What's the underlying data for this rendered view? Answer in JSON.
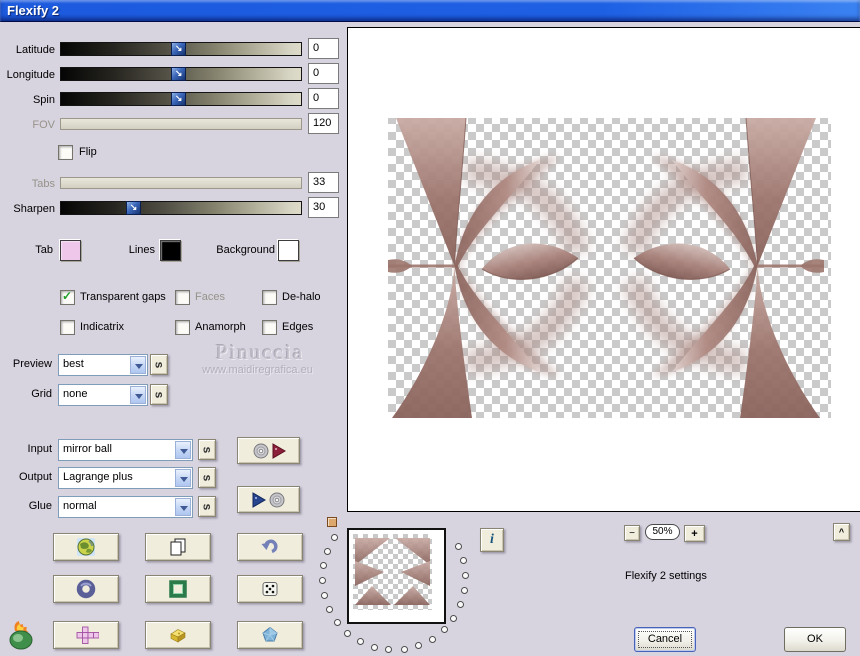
{
  "window": {
    "title": "Flexify 2"
  },
  "sliders": {
    "latitude": {
      "label": "Latitude",
      "value": "0"
    },
    "longitude": {
      "label": "Longitude",
      "value": "0"
    },
    "spin": {
      "label": "Spin",
      "value": "0"
    },
    "fov": {
      "label": "FOV",
      "value": "120"
    },
    "tabs": {
      "label": "Tabs",
      "value": "33"
    },
    "sharpen": {
      "label": "Sharpen",
      "value": "30"
    }
  },
  "flip": {
    "label": "Flip",
    "checked": false
  },
  "swatches": {
    "tab": {
      "label": "Tab",
      "color": "#eec7ea"
    },
    "lines": {
      "label": "Lines",
      "color": "#000000"
    },
    "background": {
      "label": "Background",
      "color": "#ffffff"
    }
  },
  "options": {
    "transparent_gaps": {
      "label": "Transparent gaps",
      "checked": true,
      "check_glyph": "✓"
    },
    "faces": {
      "label": "Faces",
      "checked": false,
      "disabled": true
    },
    "dehalo": {
      "label": "De-halo",
      "checked": false
    },
    "indicatrix": {
      "label": "Indicatrix",
      "checked": false
    },
    "anamorph": {
      "label": "Anamorph",
      "checked": false
    },
    "edges": {
      "label": "Edges",
      "checked": false
    }
  },
  "selects": {
    "preview": {
      "label": "Preview",
      "value": "best"
    },
    "grid": {
      "label": "Grid",
      "value": "none"
    },
    "input": {
      "label": "Input",
      "value": "mirror ball"
    },
    "output": {
      "label": "Output",
      "value": "Lagrange plus"
    },
    "glue": {
      "label": "Glue",
      "value": "normal"
    }
  },
  "s_button_label": "s",
  "watermark": {
    "line1": "Pinuccia",
    "line2": "www.maidiregrafica.eu"
  },
  "zoom_bar": {
    "minus": "−",
    "level": "50%",
    "plus": "+",
    "collapse": "^"
  },
  "info_label": "i",
  "status_text": "Flexify 2 settings",
  "actions": {
    "cancel": "Cancel",
    "ok": "OK"
  },
  "icon_names": [
    "load-settings-disc-arrow",
    "save-settings-arrow-disc",
    "globe",
    "copy-pages",
    "undo-arrow",
    "torus",
    "green-frame",
    "dice",
    "unfolded-cube",
    "cheese-box",
    "polyhedron",
    "flaming-pear-logo",
    "info",
    "planet-dial"
  ],
  "colors": {
    "titlebar_blue": "#1e60e4",
    "dialog_bg": "#d7d3df",
    "button_face": "#f0eddd",
    "art_rose_mid": "#a5837c",
    "art_rose_dark": "#7d5a54",
    "art_rose_light": "#dccbc6"
  }
}
